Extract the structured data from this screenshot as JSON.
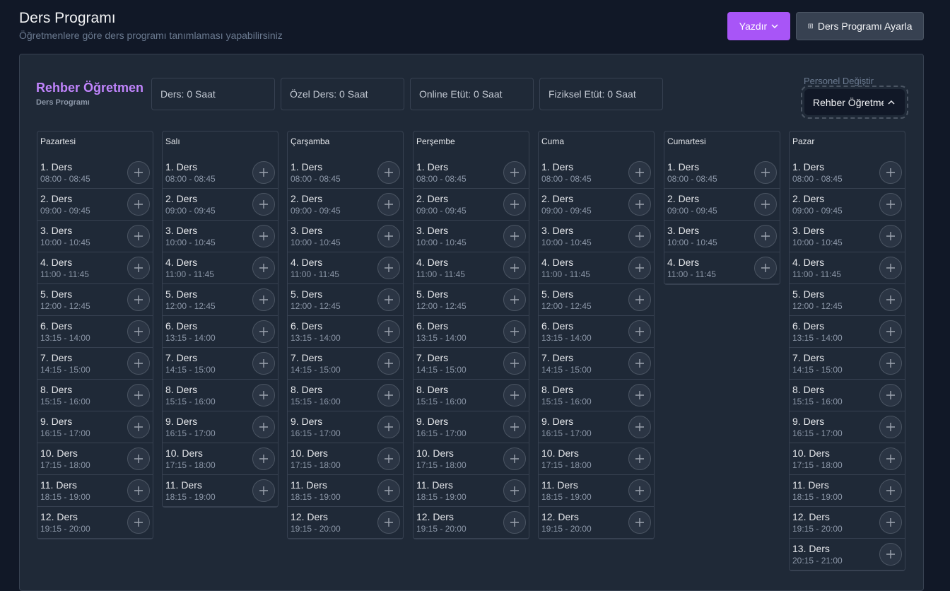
{
  "header": {
    "title": "Ders Programı",
    "subtitle": "Öğretmenlere göre ders programı tanımlaması yapabilirsiniz",
    "print_label": "Yazdır",
    "settings_label": "Ders Programı Ayarla"
  },
  "teacher": {
    "name": "Rehber Öğretmen",
    "subtitle": "Ders Programı"
  },
  "stats": [
    {
      "label": "Ders: 0 Saat"
    },
    {
      "label": "Özel Ders: 0 Saat"
    },
    {
      "label": "Online Etüt: 0 Saat"
    },
    {
      "label": "Fiziksel Etüt: 0 Saat"
    }
  ],
  "personnel": {
    "label": "Personel Değiştir",
    "selected": "Rehber Öğretmen"
  },
  "colors": {
    "accent": "#a855f7",
    "teacher_name": "#c084fc",
    "background": "#111827",
    "panel": "#1f2937"
  },
  "days": [
    {
      "name": "Pazartesi",
      "slots": [
        {
          "title": "1. Ders",
          "time": "08:00 - 08:45"
        },
        {
          "title": "2. Ders",
          "time": "09:00 - 09:45"
        },
        {
          "title": "3. Ders",
          "time": "10:00 - 10:45"
        },
        {
          "title": "4. Ders",
          "time": "11:00 - 11:45"
        },
        {
          "title": "5. Ders",
          "time": "12:00 - 12:45"
        },
        {
          "title": "6. Ders",
          "time": "13:15 - 14:00"
        },
        {
          "title": "7. Ders",
          "time": "14:15 - 15:00"
        },
        {
          "title": "8. Ders",
          "time": "15:15 - 16:00"
        },
        {
          "title": "9. Ders",
          "time": "16:15 - 17:00"
        },
        {
          "title": "10. Ders",
          "time": "17:15 - 18:00"
        },
        {
          "title": "11. Ders",
          "time": "18:15 - 19:00"
        },
        {
          "title": "12. Ders",
          "time": "19:15 - 20:00"
        }
      ]
    },
    {
      "name": "Salı",
      "slots": [
        {
          "title": "1. Ders",
          "time": "08:00 - 08:45"
        },
        {
          "title": "2. Ders",
          "time": "09:00 - 09:45"
        },
        {
          "title": "3. Ders",
          "time": "10:00 - 10:45"
        },
        {
          "title": "4. Ders",
          "time": "11:00 - 11:45"
        },
        {
          "title": "5. Ders",
          "time": "12:00 - 12:45"
        },
        {
          "title": "6. Ders",
          "time": "13:15 - 14:00"
        },
        {
          "title": "7. Ders",
          "time": "14:15 - 15:00"
        },
        {
          "title": "8. Ders",
          "time": "15:15 - 16:00"
        },
        {
          "title": "9. Ders",
          "time": "16:15 - 17:00"
        },
        {
          "title": "10. Ders",
          "time": "17:15 - 18:00"
        },
        {
          "title": "11. Ders",
          "time": "18:15 - 19:00"
        }
      ]
    },
    {
      "name": "Çarşamba",
      "slots": [
        {
          "title": "1. Ders",
          "time": "08:00 - 08:45"
        },
        {
          "title": "2. Ders",
          "time": "09:00 - 09:45"
        },
        {
          "title": "3. Ders",
          "time": "10:00 - 10:45"
        },
        {
          "title": "4. Ders",
          "time": "11:00 - 11:45"
        },
        {
          "title": "5. Ders",
          "time": "12:00 - 12:45"
        },
        {
          "title": "6. Ders",
          "time": "13:15 - 14:00"
        },
        {
          "title": "7. Ders",
          "time": "14:15 - 15:00"
        },
        {
          "title": "8. Ders",
          "time": "15:15 - 16:00"
        },
        {
          "title": "9. Ders",
          "time": "16:15 - 17:00"
        },
        {
          "title": "10. Ders",
          "time": "17:15 - 18:00"
        },
        {
          "title": "11. Ders",
          "time": "18:15 - 19:00"
        },
        {
          "title": "12. Ders",
          "time": "19:15 - 20:00"
        }
      ]
    },
    {
      "name": "Perşembe",
      "slots": [
        {
          "title": "1. Ders",
          "time": "08:00 - 08:45"
        },
        {
          "title": "2. Ders",
          "time": "09:00 - 09:45"
        },
        {
          "title": "3. Ders",
          "time": "10:00 - 10:45"
        },
        {
          "title": "4. Ders",
          "time": "11:00 - 11:45"
        },
        {
          "title": "5. Ders",
          "time": "12:00 - 12:45"
        },
        {
          "title": "6. Ders",
          "time": "13:15 - 14:00"
        },
        {
          "title": "7. Ders",
          "time": "14:15 - 15:00"
        },
        {
          "title": "8. Ders",
          "time": "15:15 - 16:00"
        },
        {
          "title": "9. Ders",
          "time": "16:15 - 17:00"
        },
        {
          "title": "10. Ders",
          "time": "17:15 - 18:00"
        },
        {
          "title": "11. Ders",
          "time": "18:15 - 19:00"
        },
        {
          "title": "12. Ders",
          "time": "19:15 - 20:00"
        }
      ]
    },
    {
      "name": "Cuma",
      "slots": [
        {
          "title": "1. Ders",
          "time": "08:00 - 08:45"
        },
        {
          "title": "2. Ders",
          "time": "09:00 - 09:45"
        },
        {
          "title": "3. Ders",
          "time": "10:00 - 10:45"
        },
        {
          "title": "4. Ders",
          "time": "11:00 - 11:45"
        },
        {
          "title": "5. Ders",
          "time": "12:00 - 12:45"
        },
        {
          "title": "6. Ders",
          "time": "13:15 - 14:00"
        },
        {
          "title": "7. Ders",
          "time": "14:15 - 15:00"
        },
        {
          "title": "8. Ders",
          "time": "15:15 - 16:00"
        },
        {
          "title": "9. Ders",
          "time": "16:15 - 17:00"
        },
        {
          "title": "10. Ders",
          "time": "17:15 - 18:00"
        },
        {
          "title": "11. Ders",
          "time": "18:15 - 19:00"
        },
        {
          "title": "12. Ders",
          "time": "19:15 - 20:00"
        }
      ]
    },
    {
      "name": "Cumartesi",
      "slots": [
        {
          "title": "1. Ders",
          "time": "08:00 - 08:45"
        },
        {
          "title": "2. Ders",
          "time": "09:00 - 09:45"
        },
        {
          "title": "3. Ders",
          "time": "10:00 - 10:45"
        },
        {
          "title": "4. Ders",
          "time": "11:00 - 11:45"
        }
      ]
    },
    {
      "name": "Pazar",
      "slots": [
        {
          "title": "1. Ders",
          "time": "08:00 - 08:45"
        },
        {
          "title": "2. Ders",
          "time": "09:00 - 09:45"
        },
        {
          "title": "3. Ders",
          "time": "10:00 - 10:45"
        },
        {
          "title": "4. Ders",
          "time": "11:00 - 11:45"
        },
        {
          "title": "5. Ders",
          "time": "12:00 - 12:45"
        },
        {
          "title": "6. Ders",
          "time": "13:15 - 14:00"
        },
        {
          "title": "7. Ders",
          "time": "14:15 - 15:00"
        },
        {
          "title": "8. Ders",
          "time": "15:15 - 16:00"
        },
        {
          "title": "9. Ders",
          "time": "16:15 - 17:00"
        },
        {
          "title": "10. Ders",
          "time": "17:15 - 18:00"
        },
        {
          "title": "11. Ders",
          "time": "18:15 - 19:00"
        },
        {
          "title": "12. Ders",
          "time": "19:15 - 20:00"
        },
        {
          "title": "13. Ders",
          "time": "20:15 - 21:00"
        }
      ]
    }
  ]
}
